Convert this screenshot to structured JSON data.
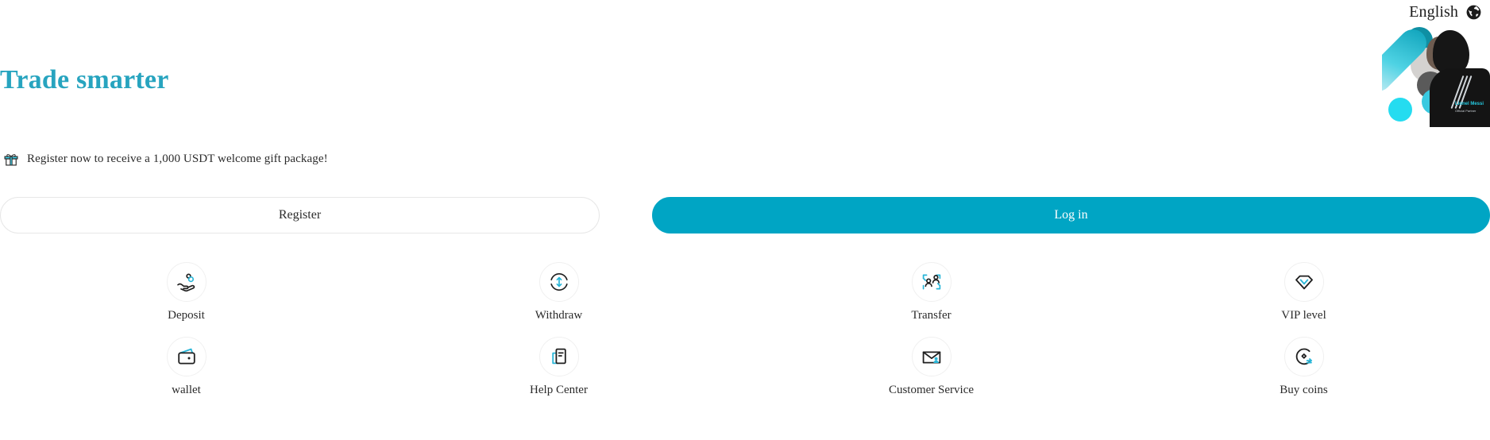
{
  "header": {
    "language_label": "English",
    "globe_icon": "globe-icon"
  },
  "hero": {
    "headline": "Trade smarter",
    "partner_name": "Lionel Messi",
    "partner_subtitle": "Official Partner"
  },
  "promo": {
    "icon": "gift-icon",
    "text": "Register now to receive a 1,000 USDT welcome gift package!"
  },
  "auth": {
    "register_label": "Register",
    "login_label": "Log in"
  },
  "shortcuts": [
    {
      "label": "Deposit",
      "icon": "deposit-hand-coin-icon"
    },
    {
      "label": "Withdraw",
      "icon": "withdraw-circle-arrows-icon"
    },
    {
      "label": "Transfer",
      "icon": "transfer-people-arrows-icon"
    },
    {
      "label": "VIP level",
      "icon": "vip-diamond-icon"
    },
    {
      "label": "wallet",
      "icon": "wallet-icon"
    },
    {
      "label": "Help Center",
      "icon": "help-center-document-icon"
    },
    {
      "label": "Customer Service",
      "icon": "customer-service-envelope-icon"
    },
    {
      "label": "Buy coins",
      "icon": "buy-coins-icon"
    }
  ],
  "colors": {
    "accent": "#00a5c4",
    "headline": "#27a4bf",
    "icon_dark": "#1f1f1f",
    "icon_accent": "#29b6d8",
    "page_background": "#ffffff"
  }
}
